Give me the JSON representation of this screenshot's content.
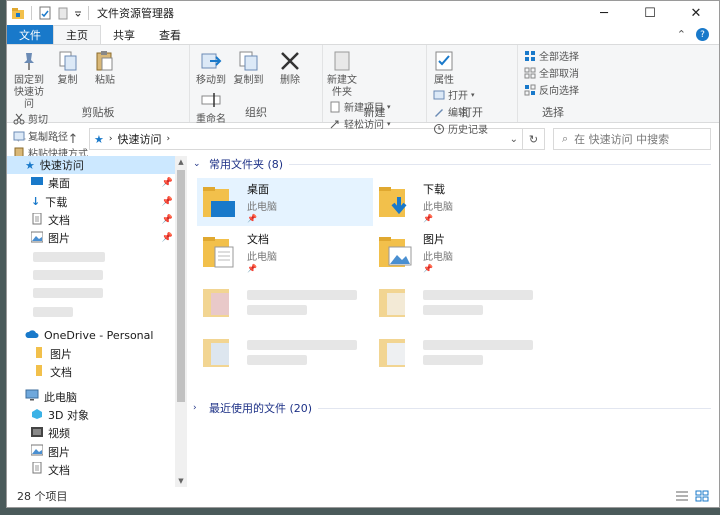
{
  "window": {
    "title": "文件资源管理器"
  },
  "tabs": {
    "file": "文件",
    "home": "主页",
    "share": "共享",
    "view": "查看"
  },
  "ribbon": {
    "pin": "固定到快速访问",
    "copy": "复制",
    "paste": "粘贴",
    "cut": "剪切",
    "copy_path": "复制路径",
    "paste_shortcut": "粘贴快捷方式",
    "clipboard_group": "剪贴板",
    "move_to": "移动到",
    "copy_to": "复制到",
    "delete": "删除",
    "rename": "重命名",
    "organize_group": "组织",
    "new_folder": "新建文件夹",
    "new_item": "新建项目",
    "easy_access": "轻松访问",
    "new_group": "新建",
    "properties": "属性",
    "open": "打开",
    "edit": "编辑",
    "history": "历史记录",
    "open_group": "打开",
    "select_all": "全部选择",
    "select_none": "全部取消",
    "invert_selection": "反向选择",
    "select_group": "选择"
  },
  "address": {
    "path": "快速访问",
    "search_placeholder": "在 快速访问 中搜索"
  },
  "nav": {
    "quick_access": "快速访问",
    "items": [
      "桌面",
      "下载",
      "文档",
      "图片"
    ],
    "onedrive": "OneDrive - Personal",
    "onedrive_items": [
      "图片",
      "文档"
    ],
    "this_pc": "此电脑",
    "pc_items": [
      "3D 对象",
      "视频",
      "图片",
      "文档"
    ]
  },
  "main": {
    "frequent_header": "常用文件夹 (8)",
    "folders": [
      {
        "name": "桌面",
        "location": "此电脑"
      },
      {
        "name": "下载",
        "location": "此电脑"
      },
      {
        "name": "文档",
        "location": "此电脑"
      },
      {
        "name": "图片",
        "location": "此电脑"
      }
    ],
    "recent_header": "最近使用的文件 (20)"
  },
  "status": {
    "count": "28 个项目"
  },
  "colors": {
    "accent": "#1979ca",
    "folder": "#f2c04b",
    "selection": "#cce8ff",
    "header": "#1e3287"
  }
}
